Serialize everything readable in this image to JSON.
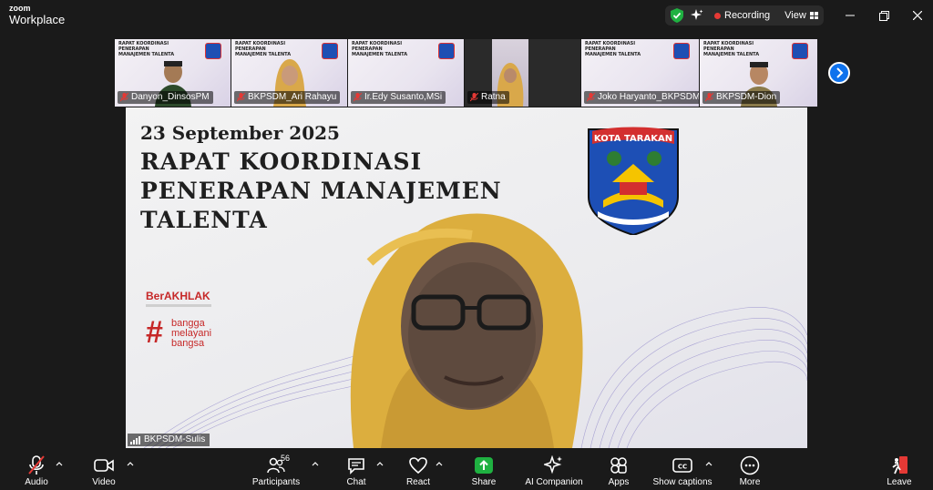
{
  "app": {
    "brand_top": "zoom",
    "brand_bottom": "Workplace"
  },
  "header": {
    "recording_label": "Recording",
    "view_label": "View"
  },
  "colors": {
    "accent": "#0e72ed",
    "recording": "#e53935",
    "brand_red": "#c62828",
    "green": "#1fb141"
  },
  "participants_strip": [
    {
      "name": "Danyon_DinsosPM"
    },
    {
      "name": "BKPSDM_Ari Rahayu"
    },
    {
      "name": "Ir.Edy Susanto,MSi"
    },
    {
      "name": "Ratna"
    },
    {
      "name": "Joko Haryanto_BKPSDM"
    },
    {
      "name": "BKPSDM-Dion"
    }
  ],
  "slide_mini": {
    "date": "23 September 2025",
    "title": "RAPAT KOORDINASI PENERAPAN MANAJEMEN TALENTA"
  },
  "slide": {
    "date": "23 September 2025",
    "title_line1": "RAPAT KOORDINASI",
    "title_line2": "PENERAPAN MANAJEMEN",
    "title_line3": "TALENTA",
    "logo_text": "KOTA TARAKAN",
    "berakhlak": "BerAKHLAK",
    "bangga_1": "bangga",
    "bangga_2": "melayani",
    "bangga_3": "bangsa"
  },
  "active_speaker": {
    "name": "BKPSDM-Sulis"
  },
  "toolbar": {
    "audio": "Audio",
    "video": "Video",
    "participants": "Participants",
    "participants_count": "56",
    "chat": "Chat",
    "react": "React",
    "share": "Share",
    "ai_companion": "AI Companion",
    "apps": "Apps",
    "captions": "Show captions",
    "more": "More",
    "leave": "Leave"
  }
}
